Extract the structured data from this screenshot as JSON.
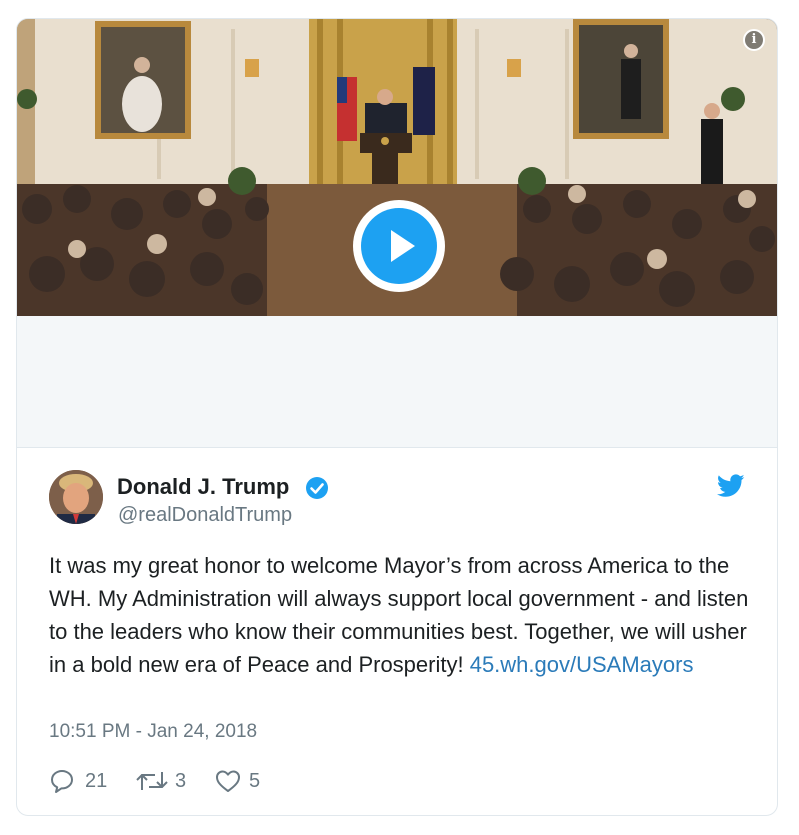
{
  "media": {
    "info_icon": "info-icon",
    "play_icon": "play-icon"
  },
  "tweet": {
    "author_name": "Donald J. Trump",
    "handle": "@realDonaldTrump",
    "text": "It was my great honor to welcome Mayor’s from across America to the WH. My Administration will always support local government - and listen to the leaders who know their communities best. Together, we will usher in a bold new era of Peace and Prosperity! ",
    "link": "45.wh.gov/USAMayors",
    "timestamp": "10:51 PM - Jan 24, 2018",
    "replies": "21",
    "retweets": "3",
    "likes": "5"
  },
  "colors": {
    "accent": "#1da1f2",
    "link": "#2b7bb9",
    "muted": "#697882",
    "text": "#1c2022"
  },
  "icons": [
    "info-icon",
    "play-icon",
    "verified-badge-icon",
    "twitter-bird-icon",
    "reply-icon",
    "retweet-icon",
    "like-icon"
  ]
}
